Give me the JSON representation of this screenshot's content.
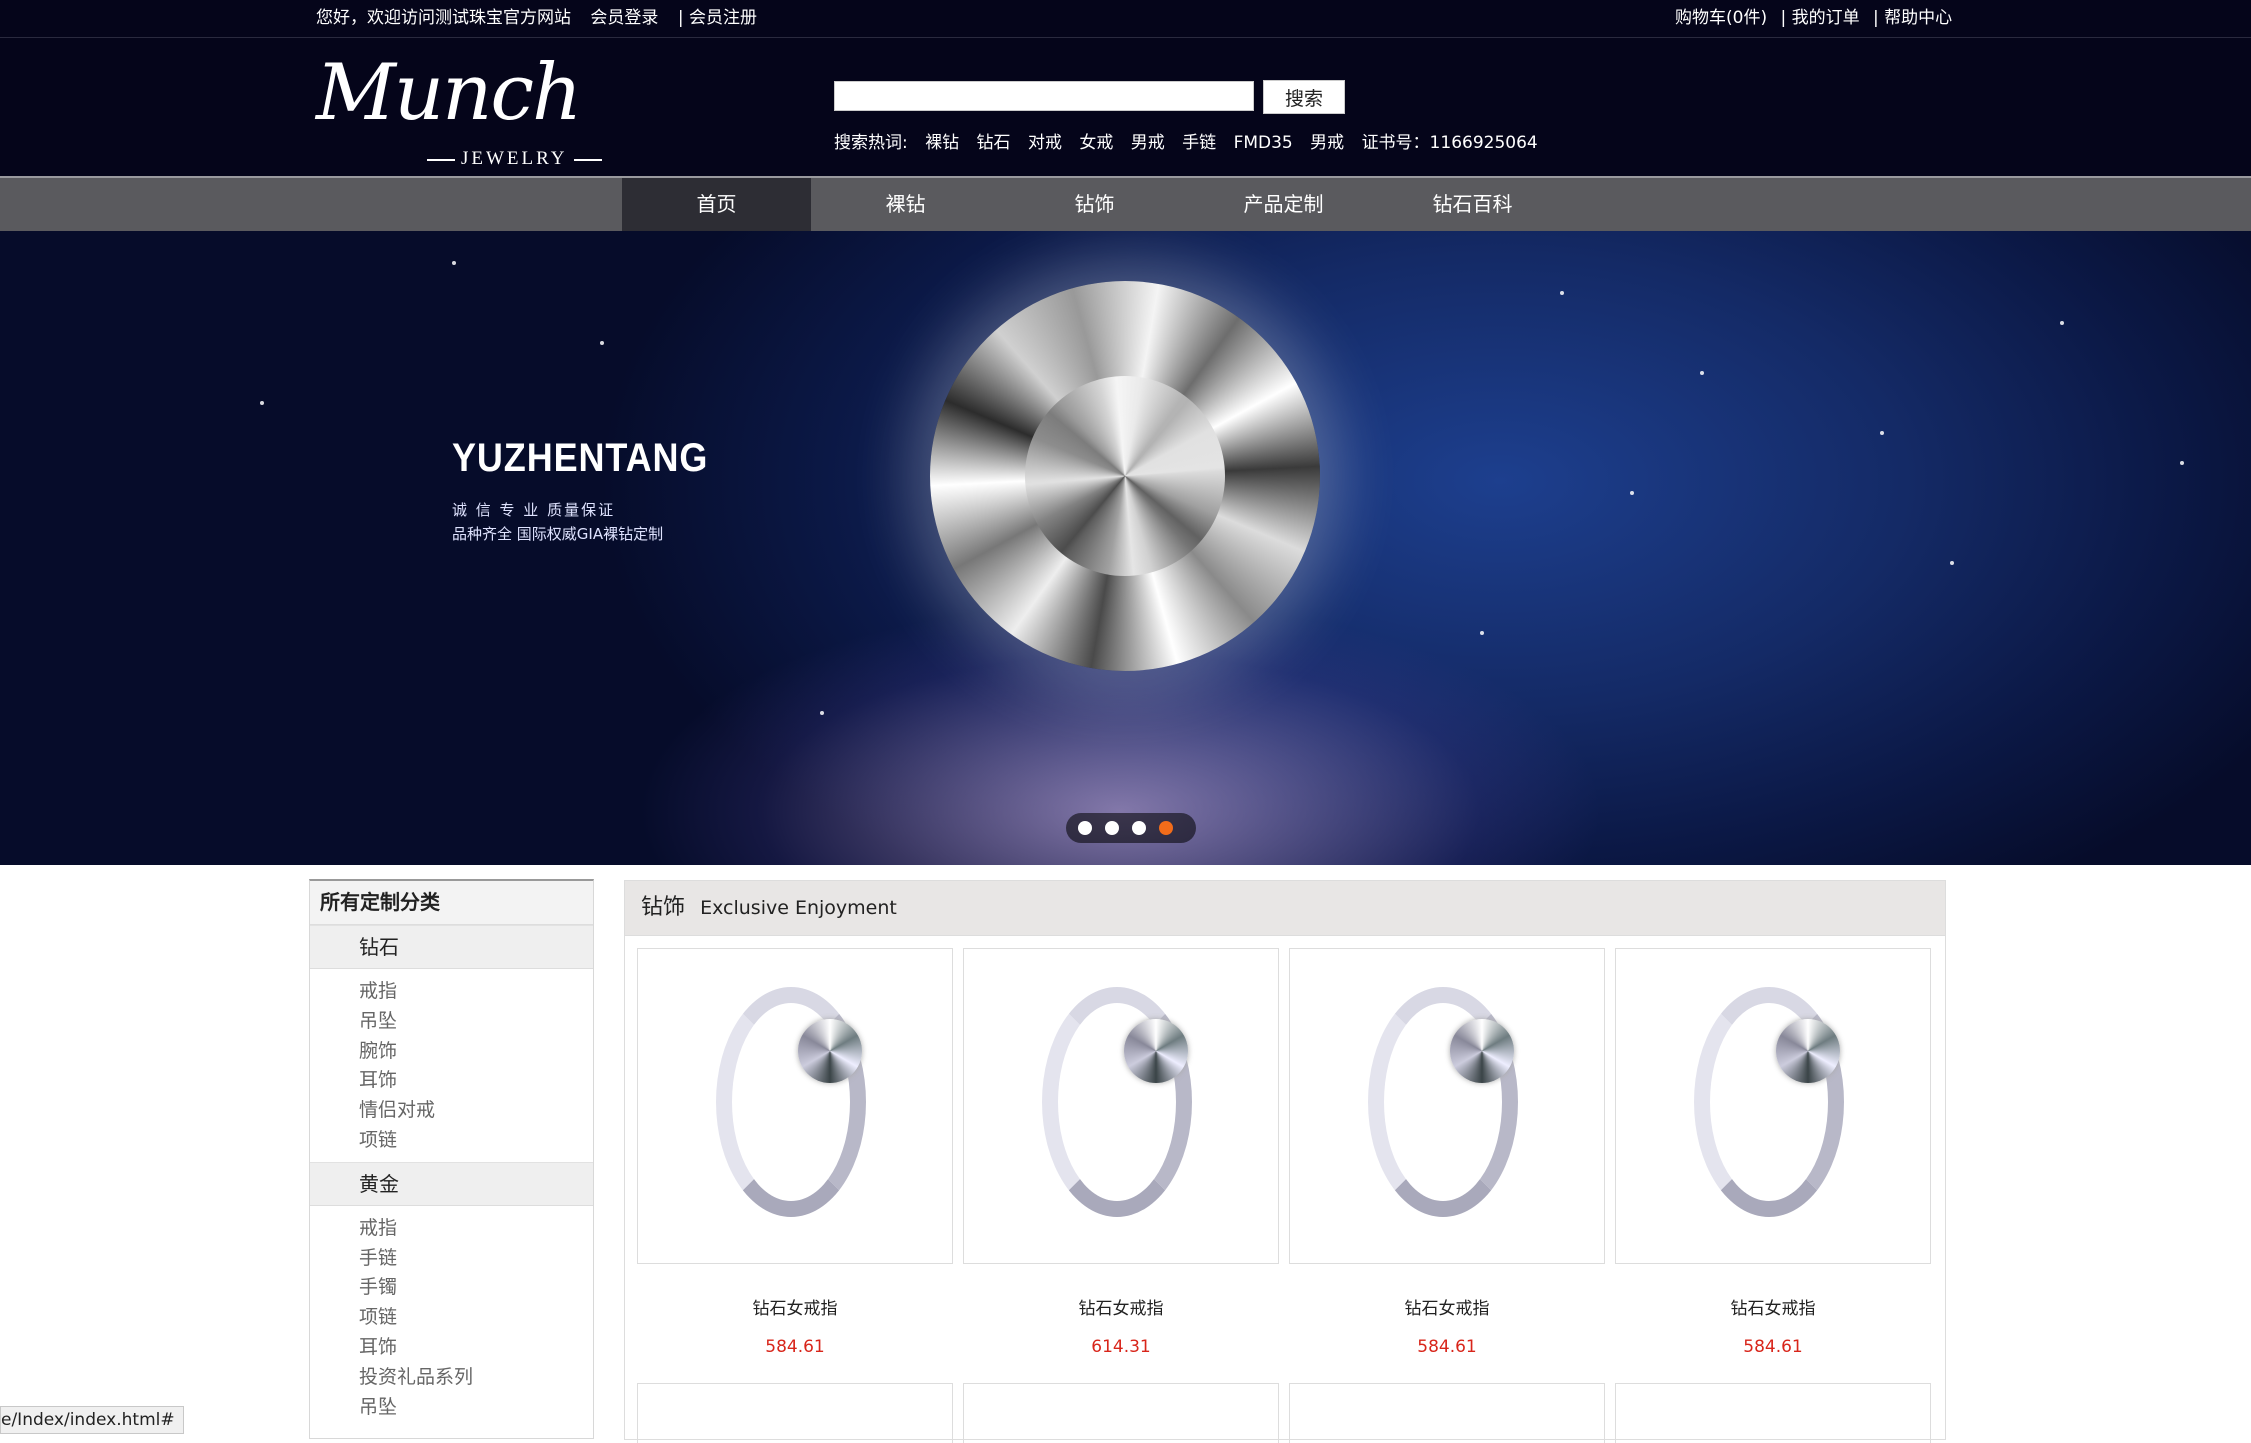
{
  "topbar": {
    "welcome": "您好，欢迎访问测试珠宝官方网站",
    "login": "会员登录",
    "register": "| 会员注册",
    "cart": "购物车(0件)",
    "orders": "| 我的订单",
    "help": "| 帮助中心"
  },
  "logo": {
    "script": "Munch",
    "sub": "JEWELRY"
  },
  "search": {
    "placeholder": "",
    "button": "搜索",
    "hot_label": "搜索热词:",
    "hot_terms": [
      "裸钻",
      "钻石",
      "对戒",
      "女戒",
      "男戒",
      "手链",
      "FMD35",
      "男戒",
      "证书号：1166925064"
    ]
  },
  "nav": {
    "items": [
      "首页",
      "裸钻",
      "钻饰",
      "产品定制",
      "钻石百科"
    ]
  },
  "banner": {
    "brand": "YUZHENTANG",
    "tagline1": "诚 信  专 业  质量保证",
    "tagline2": "品种齐全  国际权威GIA裸钻定制",
    "slide_count": 4,
    "active_slide": 4,
    "active_dot_color": "#f26c1a"
  },
  "sidebar": {
    "title": "所有定制分类",
    "groups": [
      {
        "name": "钻石",
        "items": [
          "戒指",
          "吊坠",
          "腕饰",
          "耳饰",
          "情侣对戒",
          "项链"
        ]
      },
      {
        "name": "黄金",
        "items": [
          "戒指",
          "手链",
          "手镯",
          "项链",
          "耳饰",
          "投资礼品系列",
          "吊坠"
        ]
      }
    ]
  },
  "main": {
    "title_cn": "钻饰",
    "title_en": "Exclusive Enjoyment",
    "products": [
      {
        "name": "钻石女戒指",
        "price": "584.61"
      },
      {
        "name": "钻石女戒指",
        "price": "614.31"
      },
      {
        "name": "钻石女戒指",
        "price": "584.61"
      },
      {
        "name": "钻石女戒指",
        "price": "584.61"
      }
    ],
    "price_color": "#d8251a"
  },
  "statusbar": {
    "url": "e/Index/index.html#"
  }
}
